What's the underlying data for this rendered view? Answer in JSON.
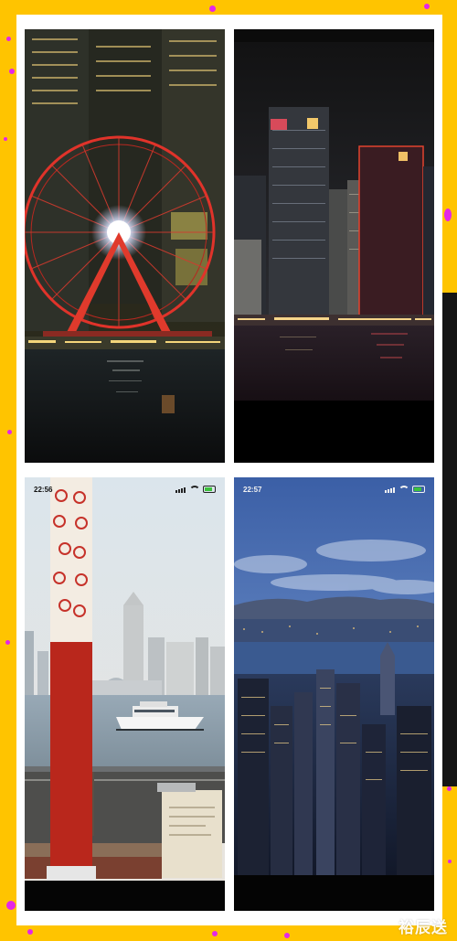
{
  "collage": {
    "background_color": "#ffc400",
    "dot_color": "#e327e8",
    "tiles": [
      {
        "name": "ferris-wheel-photo",
        "scene": "ferris-wheel-night"
      },
      {
        "name": "skyline-night-photo",
        "scene": "harbour-skyline-night"
      },
      {
        "name": "torch-harbour-photo",
        "scene": "torch-and-harbour-day",
        "status_time": "22:56"
      },
      {
        "name": "peak-view-photo",
        "scene": "victoria-peak-dusk",
        "status_time": "22:57"
      }
    ]
  },
  "watermark": "裕辰送"
}
